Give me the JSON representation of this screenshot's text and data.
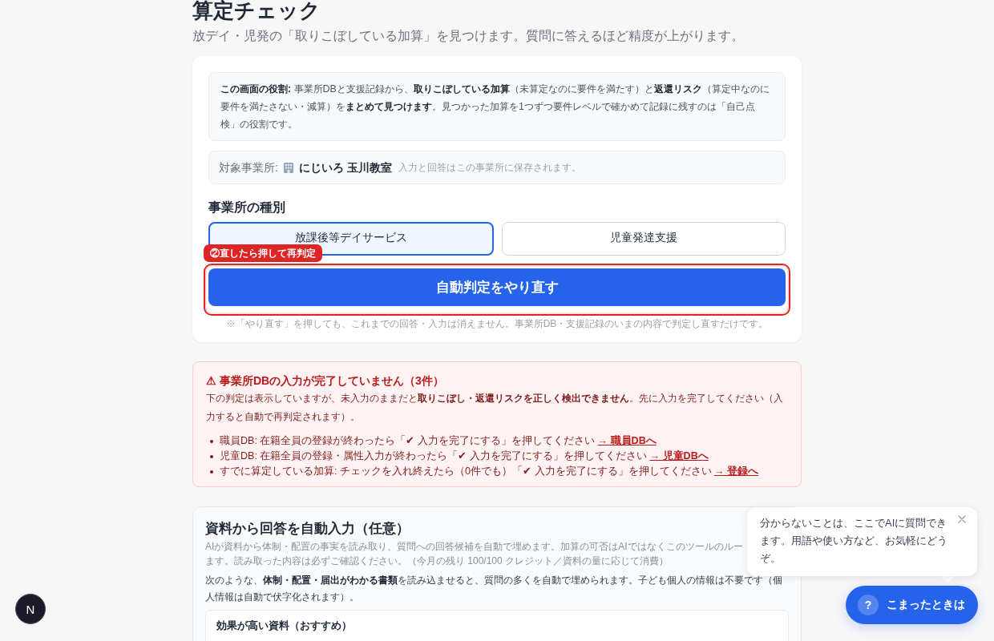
{
  "page": {
    "title": "算定チェック",
    "subtitle": "放デイ・児発の「取りこぼしている加算」を見つけます。質問に答えるほど精度が上がります。"
  },
  "role_note": "**この画面の役割:** 事業所DBと支援記録から、**取りこぼしている加算**（未算定なのに要件を満たす）と**返還リスク**（算定中なのに要件を満たさない・減算）を**まとめて見つけます**。見つかった加算を1つずつ要件レベルで確かめて記録に残すのは「自己点検」の役割です。",
  "target_facility": {
    "label": "対象事業所:",
    "name": "にじいろ 玉川教室",
    "note": "入力と回答はこの事業所に保存されます。"
  },
  "facility_type": {
    "heading": "事業所の種別",
    "options": [
      {
        "label": "放課後等デイサービス",
        "selected": true
      },
      {
        "label": "児童発達支援",
        "selected": false
      }
    ]
  },
  "rerun": {
    "hint": "②直したら押して再判定",
    "highlighted": true,
    "button": "自動判定をやり直す",
    "note": "※「やり直す」を押しても、これまでの回答・入力は消えません。事業所DB・支援記録のいまの内容で判定し直すだけです。"
  },
  "warning": {
    "title": "⚠ 事業所DBの入力が完了していません（3件）",
    "message": "下の判定は表示していますが、未入力のままだと**取りこぼし・返還リスクを正しく検出できません**。先に入力を完了してください（入力すると自動で再判定されます）。",
    "items": [
      {
        "text": "職員DB: 在籍全員の登録が終わったら「✔ 入力を完了にする」を押してください",
        "link": "→ 職員DBへ"
      },
      {
        "text": "児童DB: 在籍全員の登録・属性入力が終わったら「✔ 入力を完了にする」を押してください",
        "link": "→ 児童DBへ"
      },
      {
        "text": "すでに算定している加算: チェックを入れ終えたら（0件でも）「✔ 入力を完了にする」を押してください",
        "link": "→ 登録へ"
      }
    ]
  },
  "auto_fill": {
    "title": "資料から回答を自動入力（任意）",
    "description_lines": [
      "AIが資料から体制・配置の事実を読み取り、質問への回答候補を自動で埋めます。加算の可否はAIではなくこのツールのルー",
      "ます。読み取った内容は必ずご確認ください。（今月の残り 100/100 クレジット／資料の量に応じて消費）"
    ],
    "instructions": "次のような、**体制・配置・届出がわかる書類**を読み込ませると、質問の多くを自動で埋められます。子ども個人の情報は不要です（個人情報は自動で伏字化されます）。",
    "recommended": {
      "title": "効果が高い資料（おすすめ）"
    }
  },
  "help_tooltip": {
    "text": "分からないことは、ここでAIに質問できます。用語や使い方など、お気軽にどうぞ。"
  },
  "help_button": {
    "mark": "?",
    "label": "こまったときは"
  },
  "dev_badge": {
    "label": "N"
  }
}
